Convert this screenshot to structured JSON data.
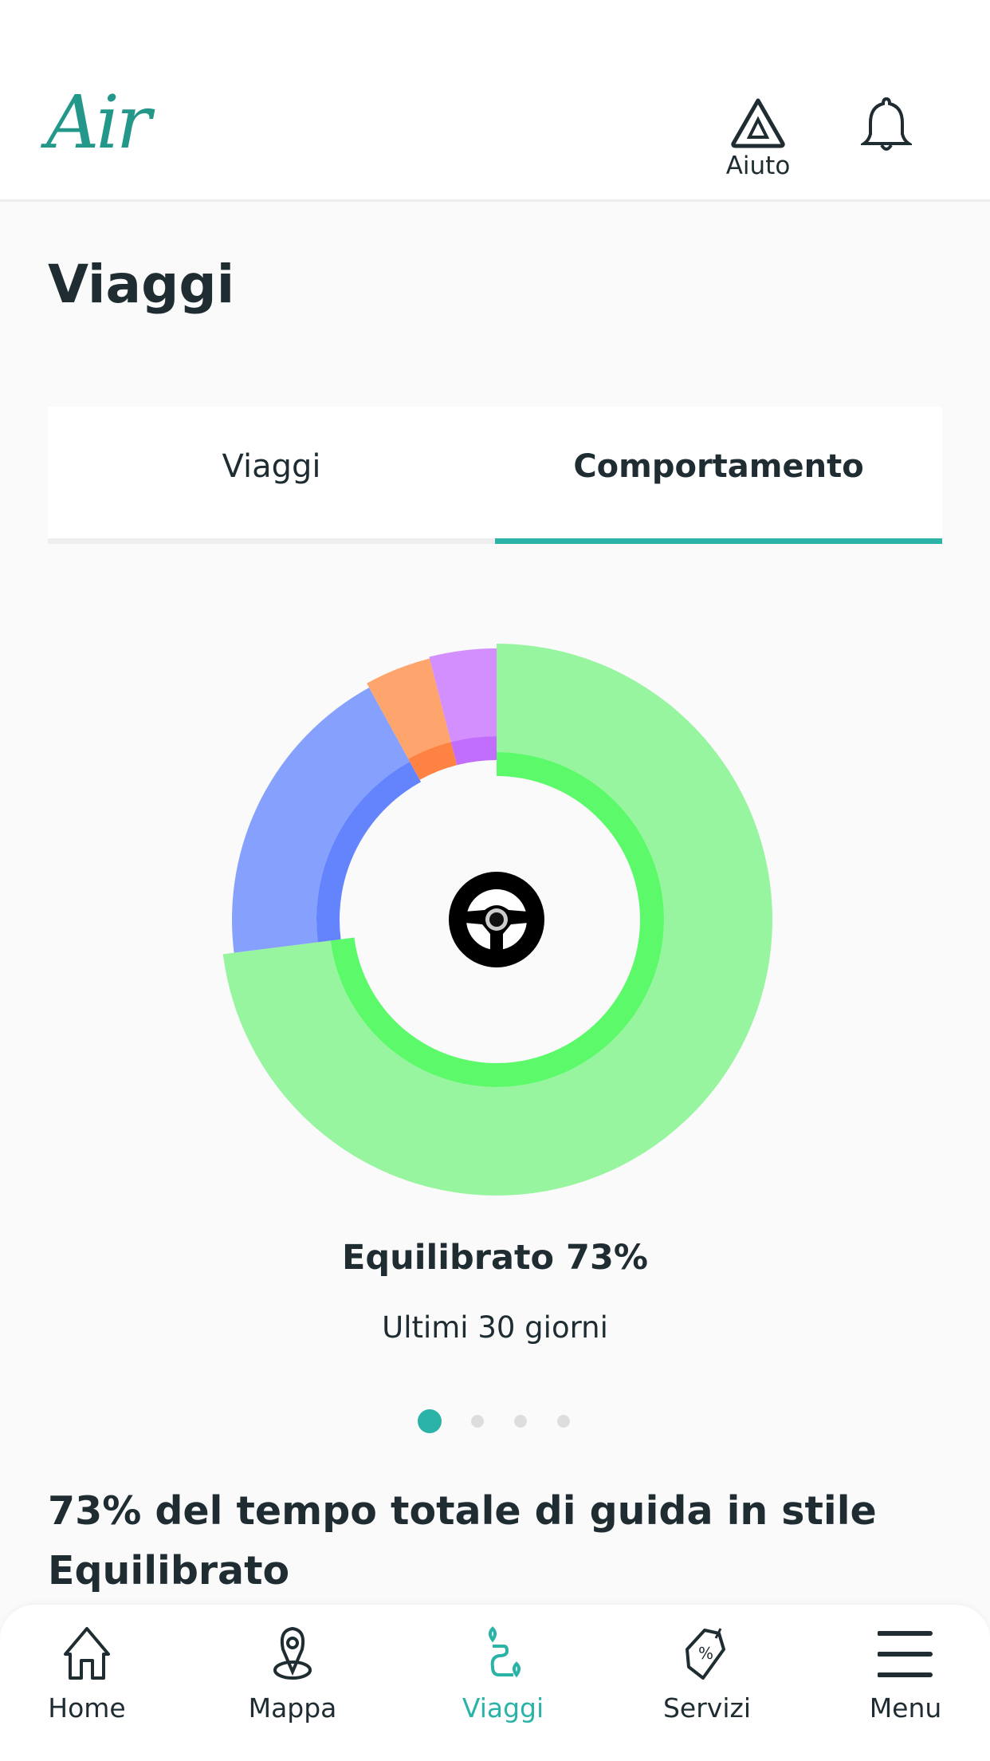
{
  "header": {
    "logo": "Air",
    "help_label": "Aiuto"
  },
  "page_title": "Viaggi",
  "tabs": [
    {
      "label": "Viaggi",
      "active": false
    },
    {
      "label": "Comportamento",
      "active": true
    }
  ],
  "accent_color": "#2bb3a8",
  "chart_data": {
    "type": "pie",
    "style": "donut",
    "slices": [
      {
        "value": 73,
        "outer_color": "#98f59f",
        "inner_color": "#5cfa6a"
      },
      {
        "value": 19,
        "outer_color": "#86a0fd",
        "inner_color": "#6484fd"
      },
      {
        "value": 4,
        "outer_color": "#fea46d",
        "inner_color": "#fe8343"
      },
      {
        "value": 4,
        "outer_color": "#d28ffd",
        "inner_color": "#c06efb"
      }
    ],
    "center_icon": "steering-wheel-icon"
  },
  "summary": {
    "title": "Equilibrato 73%",
    "subtitle": "Ultimi 30 giorni"
  },
  "pager": {
    "pages": 4,
    "current": 1
  },
  "description": "73% del tempo totale di guida in stile Equilibrato",
  "nav": [
    {
      "label": "Home",
      "icon": "home-icon"
    },
    {
      "label": "Mappa",
      "icon": "map-pin-icon"
    },
    {
      "label": "Viaggi",
      "icon": "route-icon",
      "active": true
    },
    {
      "label": "Servizi",
      "icon": "discount-tag-icon"
    },
    {
      "label": "Menu",
      "icon": "hamburger-icon"
    }
  ]
}
